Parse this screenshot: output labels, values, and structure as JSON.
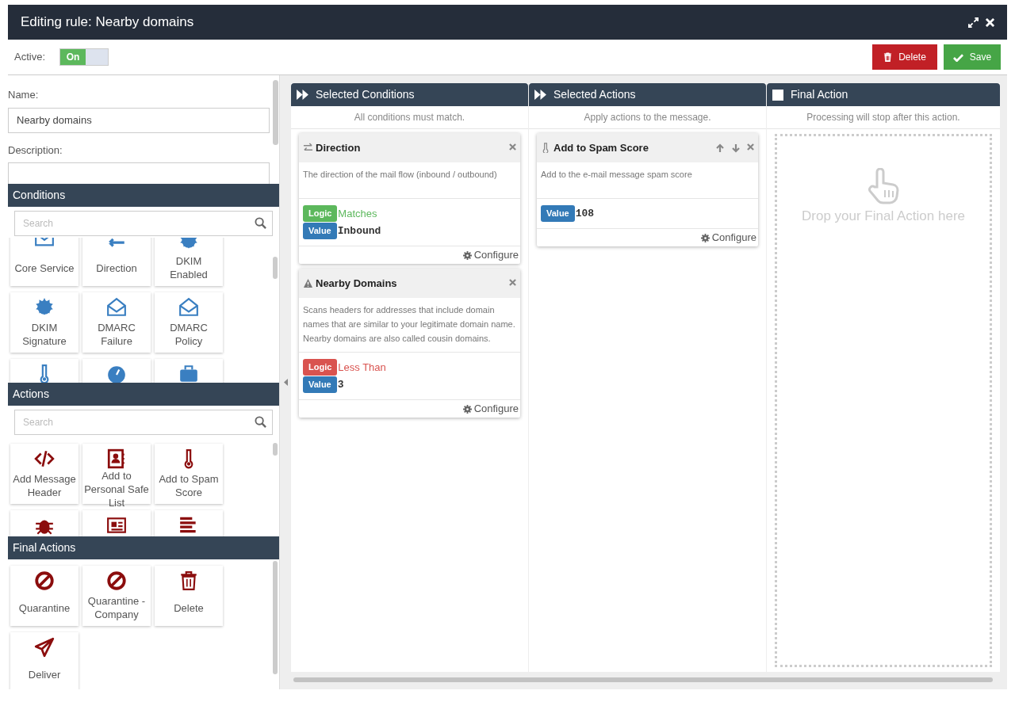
{
  "window": {
    "title": "Editing rule: Nearby domains"
  },
  "toolbar": {
    "active_label": "Active:",
    "active_toggle": {
      "label": "On",
      "on": true
    },
    "buttons": [
      {
        "label": "Delete",
        "kind": "delete"
      },
      {
        "label": "Save",
        "kind": "save"
      }
    ]
  },
  "form": {
    "name_label": "Name:",
    "name_value": "Nearby domains",
    "description_label": "Description:"
  },
  "palettes": [
    {
      "title": "Conditions",
      "search_placeholder": "Search",
      "tiles": [
        {
          "kind": "full",
          "label": "Core Service"
        },
        {
          "kind": "full",
          "label": "Direction"
        },
        {
          "kind": "full",
          "label": "DKIM Enabled"
        },
        {
          "kind": "full",
          "label": "DKIM Signature"
        },
        {
          "kind": "full",
          "label": "DMARC Failure"
        },
        {
          "kind": "full",
          "label": "DMARC Policy"
        },
        {
          "kind": "partial"
        },
        {
          "kind": "partial"
        },
        {
          "kind": "partial"
        }
      ]
    },
    {
      "title": "Actions",
      "search_placeholder": "Search",
      "tiles": [
        {
          "kind": "full",
          "label": "Add Message Header"
        },
        {
          "kind": "full",
          "label": "Add to Personal Safe List"
        },
        {
          "kind": "full",
          "label": "Add to Spam Score"
        },
        {
          "kind": "partial"
        },
        {
          "kind": "partial"
        },
        {
          "kind": "partial"
        }
      ]
    },
    {
      "title": "Final Actions",
      "tiles": [
        {
          "kind": "full",
          "label": "Quarantine"
        },
        {
          "kind": "full",
          "label": "Quarantine - Company"
        },
        {
          "kind": "full",
          "label": "Delete"
        },
        {
          "kind": "full",
          "label": "Deliver"
        }
      ]
    }
  ],
  "columns": [
    {
      "kind": "list",
      "title": "Selected Conditions",
      "subtitle": "All conditions must match.",
      "cards": [
        {
          "title": "Direction",
          "description": "The direction of the mail flow (inbound / outbound)",
          "movable": false,
          "fields": [
            {
              "kind": "logic",
              "badge": "Logic",
              "value": "Matches",
              "color": "#5cb85c"
            },
            {
              "kind": "value",
              "badge": "Value",
              "value": "Inbound",
              "color": "#337ab7"
            }
          ],
          "configure": "Configure"
        },
        {
          "title": "Nearby Domains",
          "description": "Scans headers for addresses that include domain names that are similar to your legitimate domain name. Nearby domains are also called cousin domains.",
          "movable": false,
          "fields": [
            {
              "kind": "logic",
              "badge": "Logic",
              "value": "Less Than",
              "color": "#d9534f"
            },
            {
              "kind": "value",
              "badge": "Value",
              "value": "3",
              "color": "#337ab7"
            }
          ],
          "configure": "Configure"
        }
      ]
    },
    {
      "kind": "list",
      "title": "Selected Actions",
      "subtitle": "Apply actions to the message.",
      "cards": [
        {
          "title": "Add to Spam Score",
          "description": "Add to the e-mail message spam score",
          "movable": true,
          "fields": [
            {
              "kind": "value",
              "badge": "Value",
              "value": "108",
              "color": "#337ab7"
            }
          ],
          "configure": "Configure"
        }
      ]
    },
    {
      "kind": "drop",
      "title": "Final Action",
      "subtitle": "Processing will stop after this action.",
      "drop_hint": "Drop your Final Action here"
    }
  ]
}
